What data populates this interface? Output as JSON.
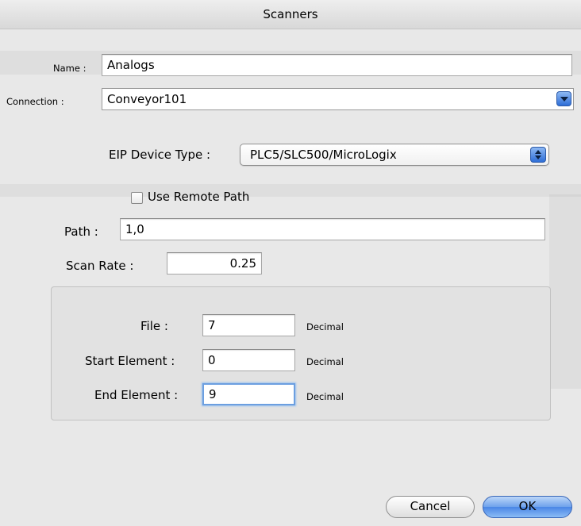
{
  "window": {
    "title": "Scanners"
  },
  "form": {
    "name": {
      "label": "Name :",
      "value": "Analogs"
    },
    "connection": {
      "label": "Connection :",
      "value": "Conveyor101"
    },
    "eip_device_type": {
      "label": "EIP Device Type :",
      "value": "PLC5/SLC500/MicroLogix"
    },
    "use_remote_path": {
      "label": "Use Remote Path",
      "checked": false
    },
    "path": {
      "label": "Path :",
      "value": "1,0"
    },
    "scan_rate": {
      "label": "Scan Rate :",
      "value": "0.25"
    }
  },
  "address": {
    "file": {
      "label": "File :",
      "value": "7",
      "format": "Decimal"
    },
    "start_element": {
      "label": "Start Element :",
      "value": "0",
      "format": "Decimal"
    },
    "end_element": {
      "label": "End Element :",
      "value": "9",
      "format": "Decimal"
    }
  },
  "buttons": {
    "cancel": "Cancel",
    "ok": "OK"
  },
  "colors": {
    "default_button": "#4a86e6",
    "focus_ring": "#6c9fe0",
    "sheet_background": "#e8e8e8"
  },
  "icons": {
    "connection_dropdown": "chevron-down-icon",
    "device_type_popup": "up-down-arrows-icon"
  }
}
